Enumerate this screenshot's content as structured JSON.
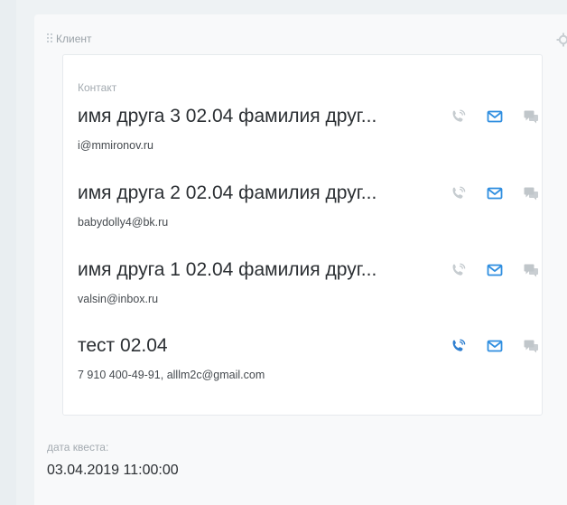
{
  "panel": {
    "title": "Клиент",
    "settings_icon": "gear-icon"
  },
  "contacts": {
    "label": "Контакт",
    "items": [
      {
        "name": "имя друга 3 02.04 фамилия друг...",
        "detail": "i@mmironov.ru",
        "phone_active": false
      },
      {
        "name": "имя друга 2 02.04 фамилия друг...",
        "detail": "babydolly4@bk.ru",
        "phone_active": false
      },
      {
        "name": "имя друга 1 02.04 фамилия друг...",
        "detail": "valsin@inbox.ru",
        "phone_active": false
      },
      {
        "name": "тест 02.04",
        "detail": "7 910 400-49-91, alllm2c@gmail.com",
        "phone_active": true
      }
    ]
  },
  "quest_date": {
    "label": "дата квеста:",
    "value": "03.04.2019 11:00:00"
  },
  "colors": {
    "phone_inactive": "#c6ccd0",
    "phone_active": "#2f7fd0",
    "mail": "#2f8ee0",
    "chat": "#c0c6ca"
  }
}
